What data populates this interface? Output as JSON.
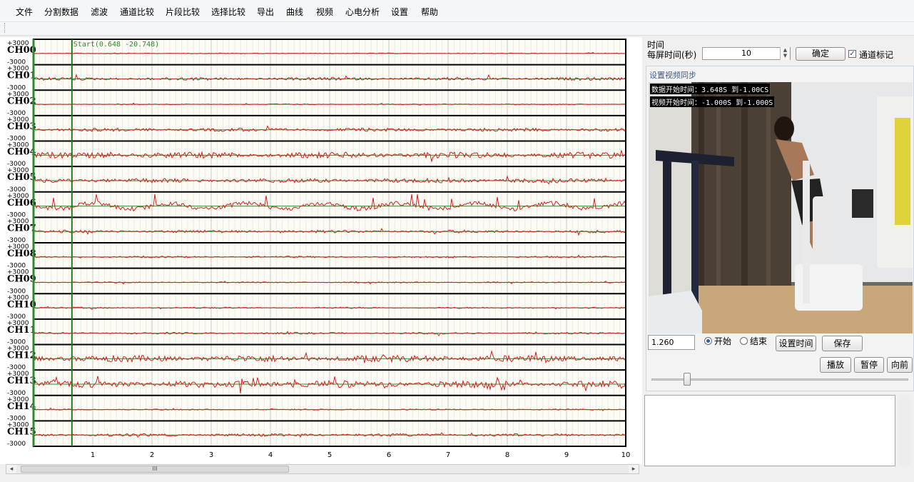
{
  "menu": [
    "文件",
    "分割数据",
    "滤波",
    "通道比较",
    "片段比较",
    "选择比较",
    "导出",
    "曲线",
    "视频",
    "心电分析",
    "设置",
    "帮助"
  ],
  "eeg": {
    "channels": [
      "CH00",
      "CH01",
      "CH02",
      "CH03",
      "CH04",
      "CH05",
      "CH06",
      "CH07",
      "CH08",
      "CH09",
      "CH10",
      "CH11",
      "CH12",
      "CH13",
      "CH14",
      "CH15"
    ],
    "scale_top": "+3000",
    "scale_bottom": "-3000",
    "x_ticks": [
      "1",
      "2",
      "3",
      "4",
      "5",
      "6",
      "7",
      "8",
      "9",
      "10"
    ],
    "x_range": [
      0,
      10
    ],
    "start_marker_x": 0.648,
    "start_label": "Start(0.648 -20.748)",
    "colors": {
      "signal": "#d42020",
      "baseline": "#2e8b2e",
      "marker": "#1e7a1e",
      "border": "#000000"
    }
  },
  "controls": {
    "time_label": "时间",
    "per_screen_label": "每屏时间(秒)",
    "per_screen_value": "10",
    "confirm_button": "确定",
    "channel_mark_label": "通道标记",
    "channel_mark_checked": true
  },
  "video": {
    "group_title": "设置视频同步",
    "overlay_line1": "数据开始时间：3.648S 到-1.00CS",
    "overlay_line2": "视频开始时间：-1.000S 到-1.000S",
    "time_value": "1.260",
    "radio_start": "开始",
    "radio_end": "结束",
    "radio_selected": "start",
    "set_time_button": "设置时间",
    "save_button": "保存",
    "play_button": "播放",
    "pause_button": "暂停",
    "forward_button": "向前"
  },
  "scrollbar_thumb_label": "III"
}
